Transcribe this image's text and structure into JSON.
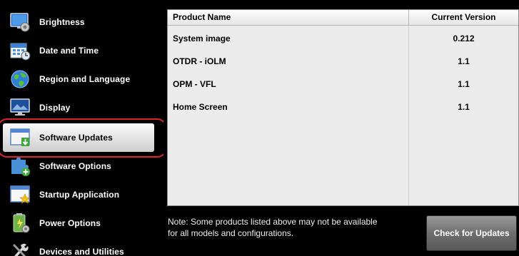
{
  "sidebar": {
    "items": [
      {
        "label": "Brightness",
        "icon": "brightness-icon"
      },
      {
        "label": "Date and Time",
        "icon": "calendar-clock-icon"
      },
      {
        "label": "Region and Language",
        "icon": "globe-icon"
      },
      {
        "label": "Display",
        "icon": "monitor-icon"
      },
      {
        "label": "Software Updates",
        "icon": "software-update-icon",
        "selected": true
      },
      {
        "label": "Software Options",
        "icon": "puzzle-plus-icon"
      },
      {
        "label": "Startup Application",
        "icon": "startup-star-icon"
      },
      {
        "label": "Power Options",
        "icon": "power-options-icon"
      },
      {
        "label": "Devices and Utilities",
        "icon": "tools-icon"
      }
    ]
  },
  "table": {
    "headers": {
      "product_name": "Product Name",
      "current_version": "Current Version"
    },
    "rows": [
      {
        "name": "System image",
        "version": "0.212"
      },
      {
        "name": "OTDR - iOLM",
        "version": "1.1"
      },
      {
        "name": "OPM - VFL",
        "version": "1.1"
      },
      {
        "name": "Home Screen",
        "version": "1.1"
      }
    ]
  },
  "note": {
    "line1": "Note: Some products listed above may not be available",
    "line2": "for all models and configurations."
  },
  "actions": {
    "check_updates_label": "Check for Updates"
  },
  "colors": {
    "selection_ring": "#d9262c",
    "background": "#000000",
    "table_bg": "#ececec"
  }
}
